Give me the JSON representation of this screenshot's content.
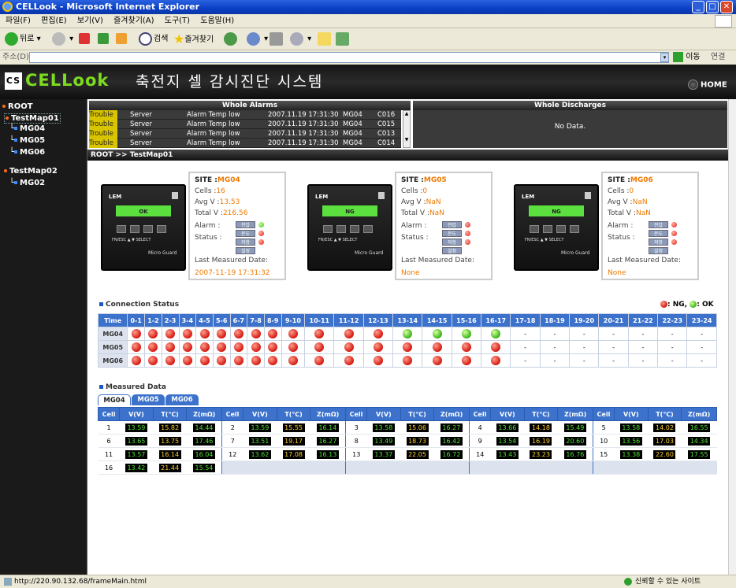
{
  "window": {
    "title": "CELLook - Microsoft Internet Explorer"
  },
  "menu": [
    "파일(F)",
    "편집(E)",
    "보기(V)",
    "즐겨찾기(A)",
    "도구(T)",
    "도움말(H)"
  ],
  "toolbar": {
    "back": "뒤로",
    "search": "검색",
    "favorites": "즐겨찾기"
  },
  "address": {
    "label": "주소(D)",
    "go": "이동",
    "links": "연결"
  },
  "app": {
    "logo": "CELLook",
    "logo_mark": "CS",
    "title": "축전지 셀 감시진단 시스템",
    "home": "HOME"
  },
  "tree": [
    "ROOT",
    "TestMap01",
    "MG04",
    "MG05",
    "MG06",
    "TestMap02",
    "MG02"
  ],
  "alarms": {
    "title": "Whole Alarms",
    "rows": [
      {
        "type": "Trouble",
        "src": "Server",
        "msg": "Alarm Temp low",
        "time": "2007.11.19  17:31:30",
        "mg": "MG04",
        "cell": "C016"
      },
      {
        "type": "Trouble",
        "src": "Server",
        "msg": "Alarm Temp low",
        "time": "2007.11.19  17:31:30",
        "mg": "MG04",
        "cell": "C015"
      },
      {
        "type": "Trouble",
        "src": "Server",
        "msg": "Alarm Temp low",
        "time": "2007.11.19  17:31:30",
        "mg": "MG04",
        "cell": "C013"
      },
      {
        "type": "Trouble",
        "src": "Server",
        "msg": "Alarm Temp low",
        "time": "2007.11.19  17:31:30",
        "mg": "MG04",
        "cell": "C014"
      }
    ]
  },
  "discharges": {
    "title": "Whole Discharges",
    "empty": "No Data."
  },
  "breadcrumb": "ROOT >> TestMap01",
  "device": {
    "brand": "LEM",
    "model": "Micro Guard",
    "keys": "FN/ESC ▲  ▼ SELECT"
  },
  "sites": [
    {
      "site_label": "SITE :",
      "site": "MG04",
      "cells_label": "Cells :",
      "cells": "16",
      "avg_label": "Avg V :",
      "avg": "13.53",
      "total_label": "Total V :",
      "total": "216.56",
      "alarm": "Alarm :",
      "status": "Status :",
      "lmd_label": "Last Measured Date:",
      "lmd": "2007-11-19 17:31:32",
      "screen": "OK",
      "btns": [
        "전압",
        "온도",
        "저항",
        "설정"
      ]
    },
    {
      "site_label": "SITE :",
      "site": "MG05",
      "cells_label": "Cells :",
      "cells": "0",
      "avg_label": "Avg V :",
      "avg": "NaN",
      "total_label": "Total V :",
      "total": "NaN",
      "alarm": "Alarm :",
      "status": "Status :",
      "lmd_label": "Last Measured Date:",
      "lmd": "None",
      "screen": "NG",
      "btns": [
        "전압",
        "온도",
        "저항",
        "설정"
      ]
    },
    {
      "site_label": "SITE :",
      "site": "MG06",
      "cells_label": "Cells :",
      "cells": "0",
      "avg_label": "Avg V :",
      "avg": "NaN",
      "total_label": "Total V :",
      "total": "NaN",
      "alarm": "Alarm :",
      "status": "Status :",
      "lmd_label": "Last Measured Date:",
      "lmd": "None",
      "screen": "NG",
      "btns": [
        "전압",
        "온도",
        "저항",
        "설정"
      ]
    }
  ],
  "connection": {
    "title": "Connection Status",
    "legend_ng": ": NG,",
    "legend_ok": ": OK",
    "head": "Time",
    "hours": [
      "0-1",
      "1-2",
      "2-3",
      "3-4",
      "4-5",
      "5-6",
      "6-7",
      "7-8",
      "8-9",
      "9-10",
      "10-11",
      "11-12",
      "12-13",
      "13-14",
      "14-15",
      "15-16",
      "16-17",
      "17-18",
      "18-19",
      "19-20",
      "20-21",
      "21-22",
      "22-23",
      "23-24"
    ],
    "rows": [
      {
        "name": "MG04",
        "states": [
          "r",
          "r",
          "r",
          "r",
          "r",
          "r",
          "r",
          "r",
          "r",
          "r",
          "r",
          "r",
          "r",
          "g",
          "g",
          "g",
          "g",
          "-",
          "-",
          "-",
          "-",
          "-",
          "-",
          "-"
        ]
      },
      {
        "name": "MG05",
        "states": [
          "r",
          "r",
          "r",
          "r",
          "r",
          "r",
          "r",
          "r",
          "r",
          "r",
          "r",
          "r",
          "r",
          "r",
          "r",
          "r",
          "r",
          "-",
          "-",
          "-",
          "-",
          "-",
          "-",
          "-"
        ]
      },
      {
        "name": "MG06",
        "states": [
          "r",
          "r",
          "r",
          "r",
          "r",
          "r",
          "r",
          "r",
          "r",
          "r",
          "r",
          "r",
          "r",
          "r",
          "r",
          "r",
          "r",
          "-",
          "-",
          "-",
          "-",
          "-",
          "-",
          "-"
        ]
      }
    ]
  },
  "measured": {
    "title": "Measured Data",
    "tabs": [
      "MG04",
      "MG05",
      "MG06"
    ],
    "cols": [
      "Cell",
      "V(V)",
      "T(℃)",
      "Z(mΩ)"
    ],
    "rows": [
      [
        [
          "1",
          "13.59",
          "15.82",
          "14.44"
        ],
        [
          "2",
          "13.59",
          "15.55",
          "16.14"
        ],
        [
          "3",
          "13.58",
          "15.06",
          "16.27"
        ],
        [
          "4",
          "13.66",
          "14.18",
          "15.49"
        ],
        [
          "5",
          "13.58",
          "14.02",
          "16.55"
        ]
      ],
      [
        [
          "6",
          "13.65",
          "13.75",
          "17.46"
        ],
        [
          "7",
          "13.51",
          "19.17",
          "16.27"
        ],
        [
          "8",
          "13.49",
          "18.73",
          "16.42"
        ],
        [
          "9",
          "13.54",
          "16.19",
          "20.60"
        ],
        [
          "10",
          "13.56",
          "17.03",
          "14.34"
        ]
      ],
      [
        [
          "11",
          "13.57",
          "16.14",
          "16.04"
        ],
        [
          "12",
          "13.62",
          "17.08",
          "16.13"
        ],
        [
          "13",
          "13.37",
          "22.05",
          "16.72"
        ],
        [
          "14",
          "13.43",
          "23.23",
          "16.76"
        ],
        [
          "15",
          "13.38",
          "22.60",
          "17.55"
        ]
      ],
      [
        [
          "16",
          "13.42",
          "21.44",
          "15.54"
        ],
        null,
        null,
        null,
        null
      ]
    ]
  },
  "status": {
    "url": "http://220.90.132.68/frameMain.html",
    "zone": "신뢰할 수 있는 사이트"
  },
  "colors": {
    "accent": "#3c72cc",
    "logo": "#7ddc1f",
    "orange": "#f07a00"
  }
}
